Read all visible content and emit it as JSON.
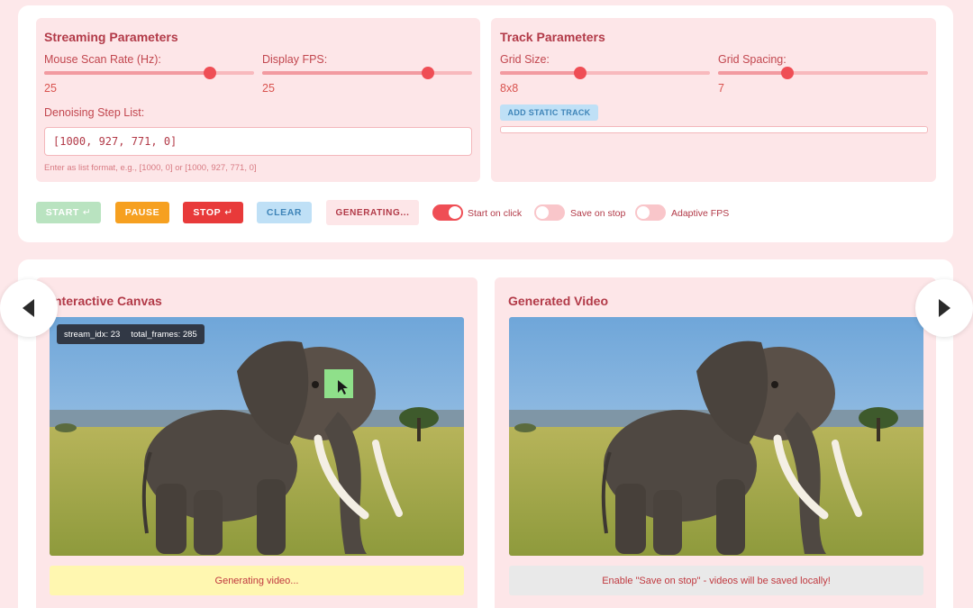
{
  "streaming": {
    "title": "Streaming Parameters",
    "mouse_scan_rate": {
      "label": "Mouse Scan Rate (Hz):",
      "value": "25",
      "fraction": 0.79
    },
    "display_fps": {
      "label": "Display FPS:",
      "value": "25",
      "fraction": 0.79
    },
    "denoise": {
      "label": "Denoising Step List:",
      "value": "[1000, 927, 771, 0]",
      "hint": "Enter as list format, e.g., [1000, 0] or [1000, 927, 771, 0]"
    }
  },
  "track": {
    "title": "Track Parameters",
    "grid_size": {
      "label": "Grid Size:",
      "value": "8x8",
      "fraction": 0.38
    },
    "grid_spacing": {
      "label": "Grid Spacing:",
      "value": "7",
      "fraction": 0.33
    },
    "add_button": "ADD STATIC TRACK"
  },
  "controls": {
    "start": "START",
    "pause": "PAUSE",
    "stop": "STOP",
    "clear": "CLEAR",
    "generating": "GENERATING...",
    "enter_glyph": "↵"
  },
  "toggles": [
    {
      "label": "Start on click",
      "on": true
    },
    {
      "label": "Save on stop",
      "on": false
    },
    {
      "label": "Adaptive FPS",
      "on": false
    }
  ],
  "canvas": {
    "title": "nteractive Canvas",
    "overlay_stream": "stream_idx: 23",
    "overlay_frames": "total_frames: 285",
    "status": "Generating video..."
  },
  "video": {
    "title": "Generated Video",
    "status": "Enable \"Save on stop\" - videos will be saved locally!"
  },
  "icons": {
    "prev": "chevron-left-icon",
    "next": "chevron-right-icon",
    "cursor": "cursor-icon"
  },
  "colors": {
    "accent": "#ef4e55",
    "panel": "#fde6e8",
    "start_btn": "#b9e3c0",
    "pause_btn": "#f6a020",
    "stop_btn": "#e83a3a",
    "clear_btn": "#bfe0f6",
    "canvas_status": "#fff7b0",
    "video_status": "#e9e9e9",
    "marker": "#8fe08a"
  }
}
